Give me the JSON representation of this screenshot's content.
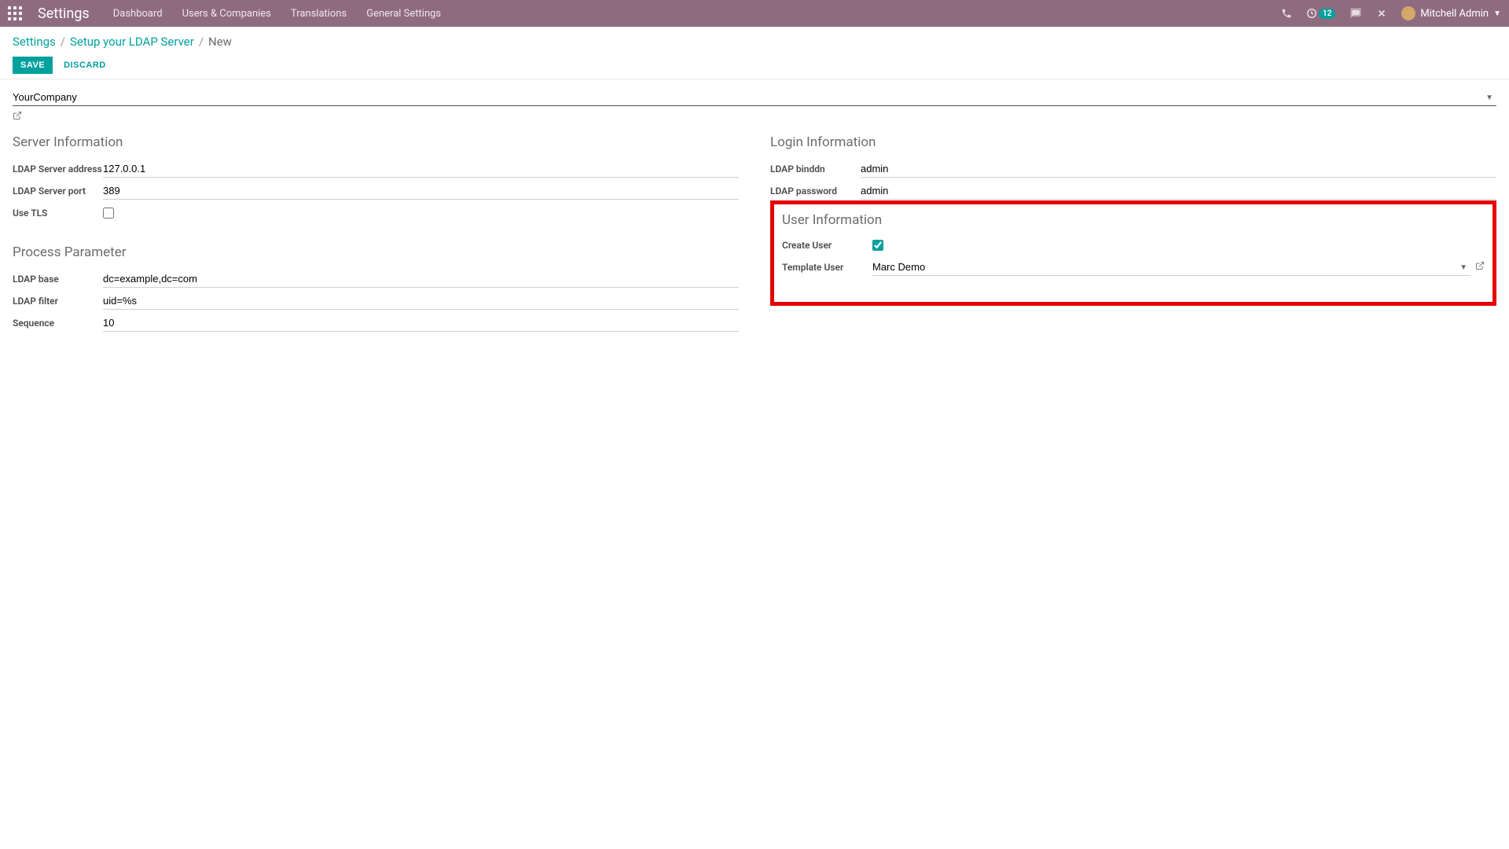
{
  "topbar": {
    "app_title": "Settings",
    "nav": [
      "Dashboard",
      "Users & Companies",
      "Translations",
      "General Settings"
    ],
    "activity_count": "12",
    "user_name": "Mitchell Admin"
  },
  "breadcrumb": {
    "root": "Settings",
    "mid": "Setup your LDAP Server",
    "current": "New"
  },
  "buttons": {
    "save": "SAVE",
    "discard": "DISCARD"
  },
  "company": "YourCompany",
  "sections": {
    "server_info": "Server Information",
    "login_info": "Login Information",
    "process_param": "Process Parameter",
    "user_info": "User Information"
  },
  "fields": {
    "server_address_label": "LDAP Server address",
    "server_address": "127.0.0.1",
    "server_port_label": "LDAP Server port",
    "server_port": "389",
    "use_tls_label": "Use TLS",
    "binddn_label": "LDAP binddn",
    "binddn": "admin",
    "password_label": "LDAP password",
    "password": "admin",
    "base_label": "LDAP base",
    "base": "dc=example,dc=com",
    "filter_label": "LDAP filter",
    "filter": "uid=%s",
    "sequence_label": "Sequence",
    "sequence": "10",
    "create_user_label": "Create User",
    "template_user_label": "Template User",
    "template_user": "Marc Demo"
  }
}
